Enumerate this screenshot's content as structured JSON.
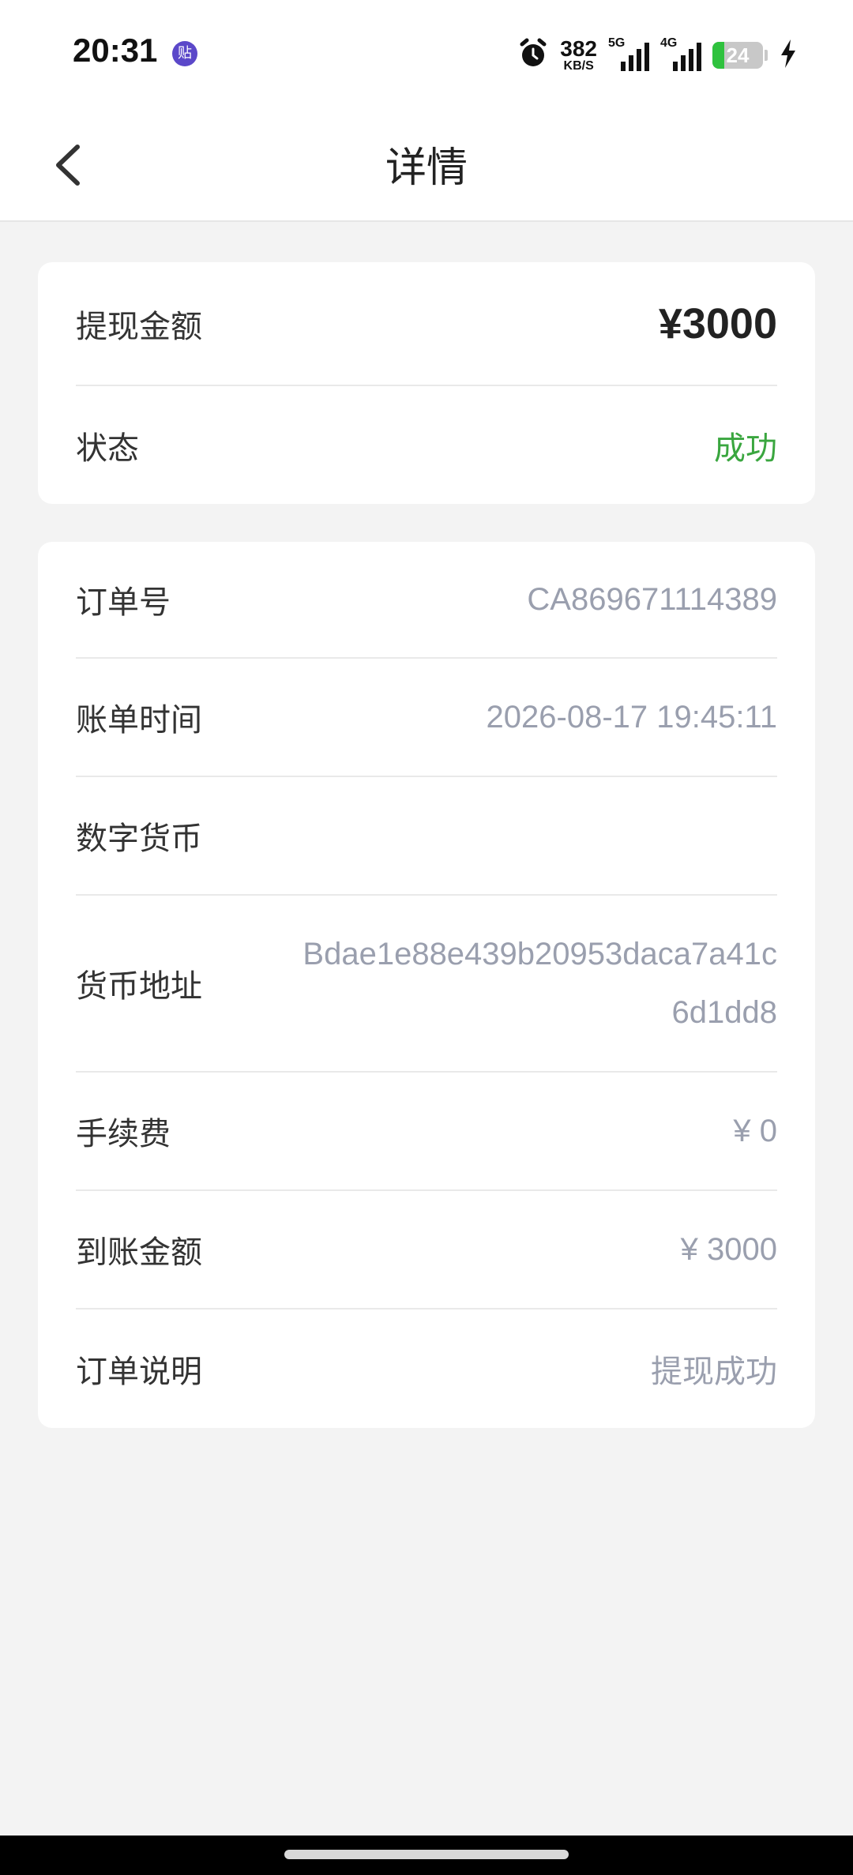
{
  "status_bar": {
    "time": "20:31",
    "app_badge": "贴",
    "net_speed_value": "382",
    "net_speed_unit": "KB/S",
    "signal_1_tag": "5G",
    "signal_2_tag": "4G",
    "battery_level": "24",
    "battery_fraction": 0.24,
    "icons": [
      "alarm-icon",
      "signal-5g-icon",
      "signal-4g-icon",
      "battery-icon",
      "charging-icon"
    ]
  },
  "nav": {
    "title": "详情",
    "back_icon": "chevron-left-icon"
  },
  "summary": {
    "amount_label": "提现金额",
    "amount_value": "¥3000",
    "status_label": "状态",
    "status_value": "成功",
    "status_color": "#3aa63f"
  },
  "details": {
    "order_no_label": "订单号",
    "order_no_value": "CA869671114389",
    "bill_time_label": "账单时间",
    "bill_time_value": "2026-08-17 19:45:11",
    "currency_label": "数字货币",
    "currency_value": "",
    "address_label": "货币地址",
    "address_value": "Bdae1e88e439b20953daca7a41c6d1dd8",
    "fee_label": "手续费",
    "fee_value": "¥ 0",
    "received_label": "到账金额",
    "received_value": "¥ 3000",
    "note_label": "订单说明",
    "note_value": "提现成功"
  },
  "colors": {
    "background": "#f3f3f3",
    "card": "#ffffff",
    "muted_value": "#9a9fae",
    "success": "#3aa63f"
  }
}
